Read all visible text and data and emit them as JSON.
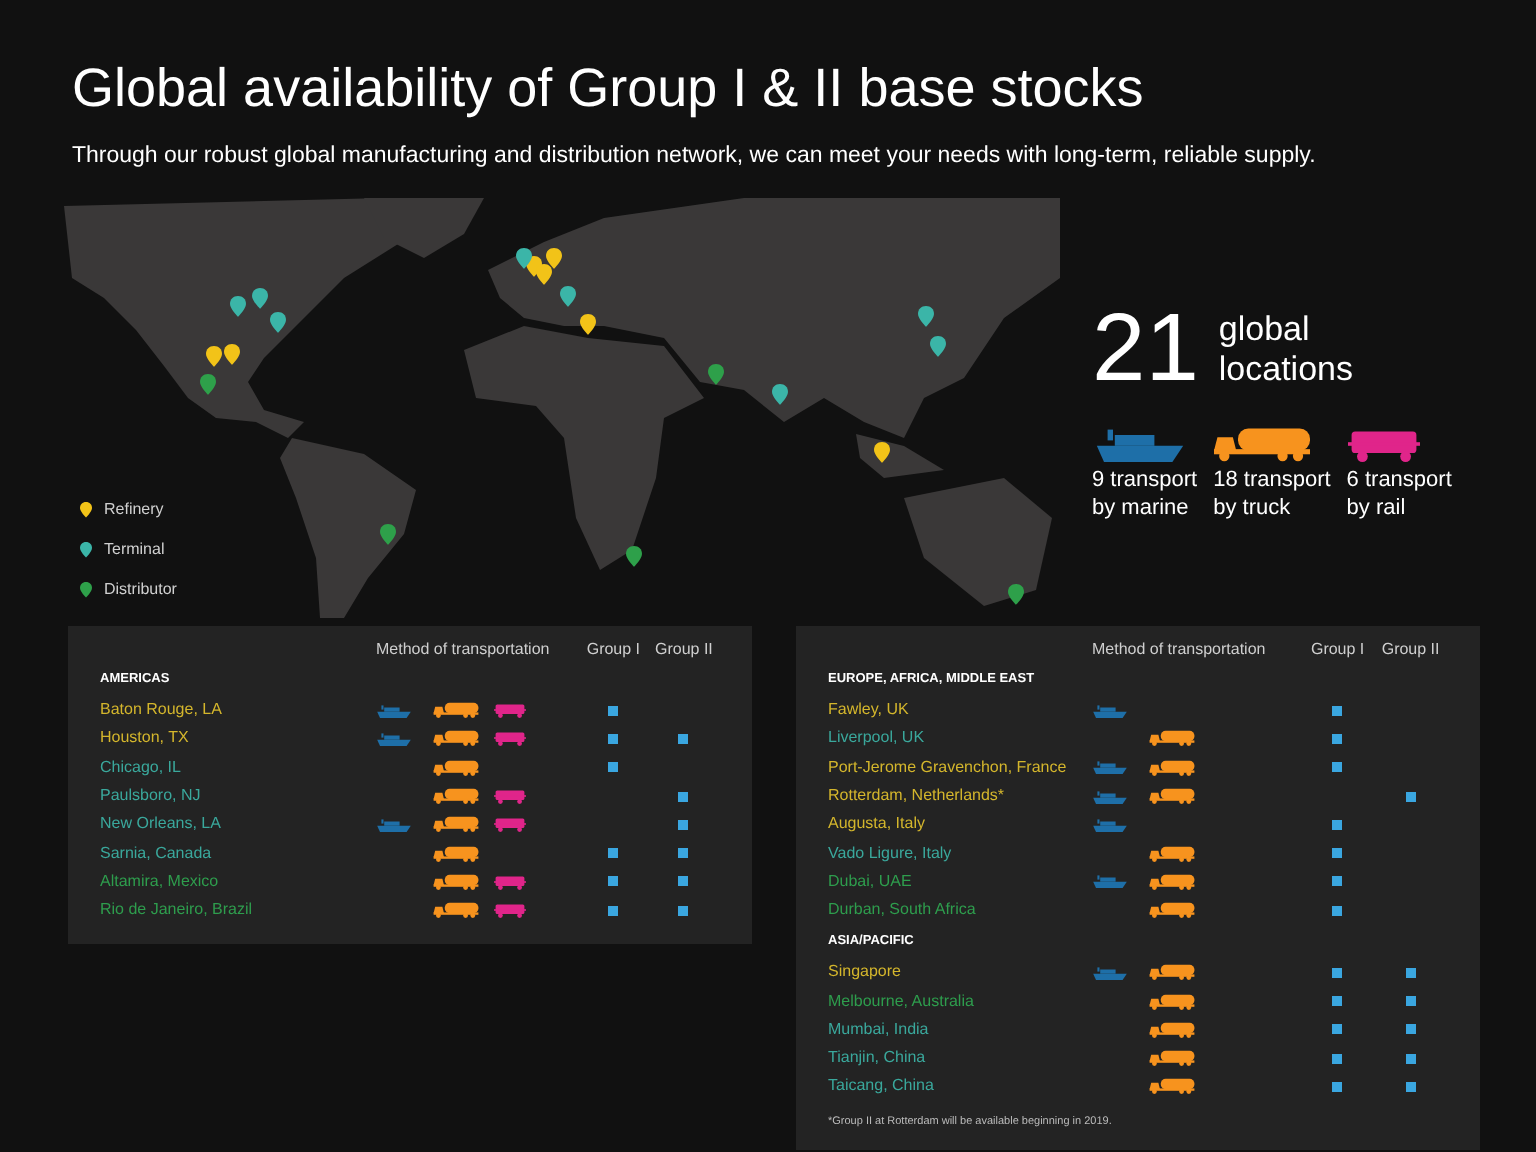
{
  "title": "Global availability of Group I & II base stocks",
  "subtitle": "Through our robust global manufacturing and distribution network, we can meet your needs with long-term, reliable supply.",
  "legend": [
    {
      "label": "Refinery",
      "color": "#f2c318"
    },
    {
      "label": "Terminal",
      "color": "#3bb5a8"
    },
    {
      "label": "Distributor",
      "color": "#2ea04a"
    }
  ],
  "stats": {
    "count": "21",
    "label_lines": [
      "global",
      "locations"
    ],
    "transports": [
      {
        "kind": "marine",
        "lines": [
          "9 transport",
          "by marine"
        ]
      },
      {
        "kind": "truck",
        "lines": [
          "18 transport",
          "by truck"
        ]
      },
      {
        "kind": "rail",
        "lines": [
          "6 transport",
          "by rail"
        ]
      }
    ]
  },
  "tables": [
    {
      "columns": [
        "Method of transportation",
        "Group I",
        "Group II"
      ],
      "sections": [
        {
          "heading": "AMERICAS",
          "rows": [
            {
              "name": "Baton Rouge, LA",
              "color": "#d4b62c",
              "marine": true,
              "truck": true,
              "rail": true,
              "group_1": true,
              "group_2": false
            },
            {
              "name": "Houston, TX",
              "color": "#d4b62c",
              "marine": true,
              "truck": true,
              "rail": true,
              "group_1": true,
              "group_2": true
            },
            {
              "name": "Chicago, IL",
              "color": "#3aa89c",
              "marine": false,
              "truck": true,
              "rail": false,
              "group_1": true,
              "group_2": false
            },
            {
              "name": "Paulsboro, NJ",
              "color": "#3aa89c",
              "marine": false,
              "truck": true,
              "rail": true,
              "group_1": false,
              "group_2": true
            },
            {
              "name": "New Orleans, LA",
              "color": "#3aa89c",
              "marine": true,
              "truck": true,
              "rail": true,
              "group_1": false,
              "group_2": true
            },
            {
              "name": "Sarnia, Canada",
              "color": "#3aa89c",
              "marine": false,
              "truck": true,
              "rail": false,
              "group_1": true,
              "group_2": true
            },
            {
              "name": "Altamira, Mexico",
              "color": "#2e9d4d",
              "marine": false,
              "truck": true,
              "rail": true,
              "group_1": true,
              "group_2": true
            },
            {
              "name": "Rio de Janeiro, Brazil",
              "color": "#2e9d4d",
              "marine": false,
              "truck": true,
              "rail": true,
              "group_1": true,
              "group_2": true
            }
          ]
        }
      ]
    },
    {
      "columns": [
        "Method of transportation",
        "Group I",
        "Group II"
      ],
      "sections": [
        {
          "heading": "EUROPE, AFRICA, MIDDLE EAST",
          "rows": [
            {
              "name": "Fawley, UK",
              "color": "#d4b62c",
              "marine": true,
              "truck": false,
              "rail": false,
              "group_1": true,
              "group_2": false
            },
            {
              "name": "Liverpool, UK",
              "color": "#3aa89c",
              "marine": false,
              "truck": true,
              "rail": false,
              "group_1": true,
              "group_2": false
            },
            {
              "name": "Port-Jerome Gravenchon, France",
              "color": "#d4b62c",
              "marine": true,
              "truck": true,
              "rail": false,
              "group_1": true,
              "group_2": false
            },
            {
              "name": "Rotterdam, Netherlands*",
              "color": "#d4b62c",
              "marine": true,
              "truck": true,
              "rail": false,
              "group_1": false,
              "group_2": true
            },
            {
              "name": "Augusta, Italy",
              "color": "#d4b62c",
              "marine": true,
              "truck": false,
              "rail": false,
              "group_1": true,
              "group_2": false
            },
            {
              "name": "Vado Ligure, Italy",
              "color": "#3aa89c",
              "marine": false,
              "truck": true,
              "rail": false,
              "group_1": true,
              "group_2": false
            },
            {
              "name": "Dubai, UAE",
              "color": "#2e9d4d",
              "marine": true,
              "truck": true,
              "rail": false,
              "group_1": true,
              "group_2": false
            },
            {
              "name": "Durban, South Africa",
              "color": "#2e9d4d",
              "marine": false,
              "truck": true,
              "rail": false,
              "group_1": true,
              "group_2": false
            }
          ]
        },
        {
          "heading": "ASIA/PACIFIC",
          "rows": [
            {
              "name": "Singapore",
              "color": "#d4b62c",
              "marine": true,
              "truck": true,
              "rail": false,
              "group_1": true,
              "group_2": true
            },
            {
              "name": "Melbourne, Australia",
              "color": "#2e9d4d",
              "marine": false,
              "truck": true,
              "rail": false,
              "group_1": true,
              "group_2": true
            },
            {
              "name": "Mumbai, India",
              "color": "#3aa89c",
              "marine": false,
              "truck": true,
              "rail": false,
              "group_1": true,
              "group_2": true
            },
            {
              "name": "Tianjin, China",
              "color": "#3aa89c",
              "marine": false,
              "truck": true,
              "rail": false,
              "group_1": true,
              "group_2": true
            },
            {
              "name": "Taicang, China",
              "color": "#3aa89c",
              "marine": false,
              "truck": true,
              "rail": false,
              "group_1": true,
              "group_2": true
            }
          ]
        }
      ],
      "footnote": "*Group II at Rotterdam will be available beginning in 2019."
    }
  ]
}
